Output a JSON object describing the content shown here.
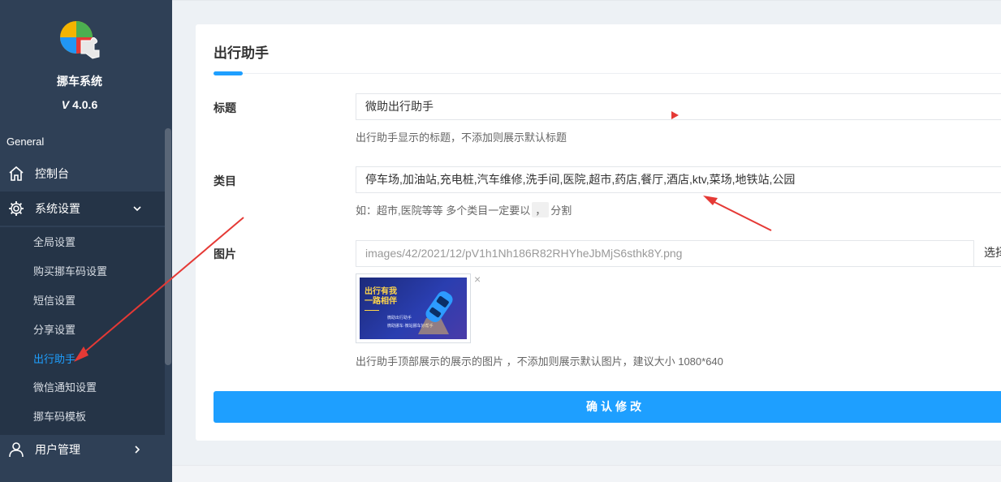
{
  "sidebar": {
    "app_name": "挪车系统",
    "version_mark": "V",
    "version": "4.0.6",
    "section_label": "General",
    "items": [
      {
        "label": "控制台",
        "icon": "home-icon"
      },
      {
        "label": "系统设置",
        "icon": "gear-icon",
        "expanded": true
      },
      {
        "label": "用户管理",
        "icon": "user-icon"
      }
    ],
    "submenu": [
      {
        "label": "全局设置"
      },
      {
        "label": "购买挪车码设置"
      },
      {
        "label": "短信设置"
      },
      {
        "label": "分享设置"
      },
      {
        "label": "出行助手",
        "current": true
      },
      {
        "label": "微信通知设置"
      },
      {
        "label": "挪车码模板"
      }
    ]
  },
  "page": {
    "title": "出行助手"
  },
  "form": {
    "title_field": {
      "label": "标题",
      "value": "微助出行助手",
      "hint": "出行助手显示的标题，不添加则展示默认标题"
    },
    "category_field": {
      "label": "类目",
      "value": "停车场,加油站,充电桩,汽车维修,洗手间,医院,超市,药店,餐厅,酒店,ktv,菜场,地铁站,公园",
      "hint_before": "如：超市,医院等等 多个类目一定要以",
      "hint_chip": "，",
      "hint_after": "分割"
    },
    "image_field": {
      "label": "图片",
      "value": "images/42/2021/12/pV1h1Nh186R82RHYheJbMjS6sthk8Y.png",
      "choose_label": "选择",
      "banner_title_line1": "出行有我",
      "banner_title_line2": "一路相伴",
      "banner_sub1": "微助出行助手",
      "banner_sub2": "微助挪车·微站挪车好帮手",
      "remove_glyph": "×",
      "hint": "出行助手顶部展示的展示的图片 ，不添加则展示默认图片，建议大小 1080*640"
    },
    "submit_label": "确认修改"
  },
  "colors": {
    "sidebar_bg": "#2f4056",
    "accent": "#1e9fff",
    "annotation": "#e53935"
  }
}
